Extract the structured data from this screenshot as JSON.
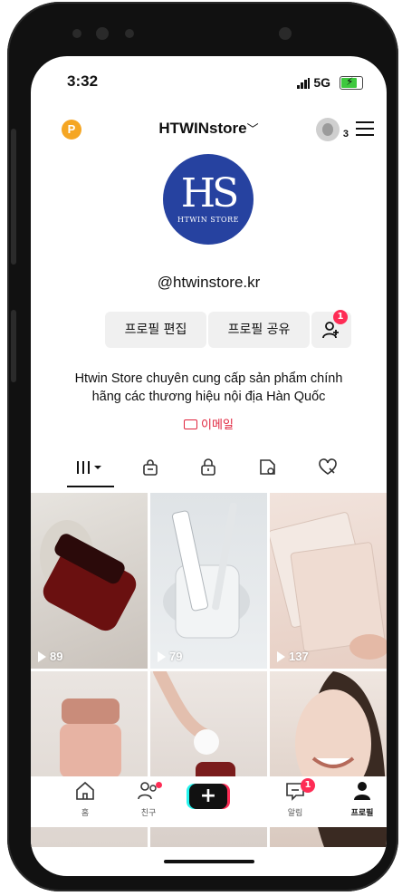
{
  "status": {
    "time": "3:32",
    "network": "5G"
  },
  "header": {
    "points_badge": "P",
    "username": "HTWINstore",
    "dropdown_icon": "chevron-down-icon",
    "accounts_count": "3",
    "menu_icon": "hamburger-icon"
  },
  "profile": {
    "avatar_monogram": "HS",
    "avatar_brand": "HTWIN STORE",
    "handle": "@htwinstore.kr",
    "edit_label": "프로필 편집",
    "share_label": "프로필 공유",
    "friends_badge": "1",
    "bio_line1": "Htwin Store chuyên cung cấp sản phẩm chính",
    "bio_line2": "hãng các thương hiệu nội địa Hàn Quốc",
    "email_label": "이메일"
  },
  "tabs": [
    {
      "icon": "grid-icon"
    },
    {
      "icon": "shopping-bag-icon"
    },
    {
      "icon": "lock-icon"
    },
    {
      "icon": "tagged-icon"
    },
    {
      "icon": "liked-icon"
    }
  ],
  "grid": [
    {
      "views": "89"
    },
    {
      "views": "79"
    },
    {
      "views": "137"
    },
    {
      "views": ""
    },
    {
      "views": ""
    },
    {
      "views": ""
    }
  ],
  "nav": {
    "home": "홈",
    "friends": "친구",
    "inbox": "알림",
    "inbox_badge": "1",
    "profile": "프로필"
  },
  "colors": {
    "accent": "#fe2c55",
    "brand_blue": "#2642a0",
    "points": "#f5a623"
  }
}
